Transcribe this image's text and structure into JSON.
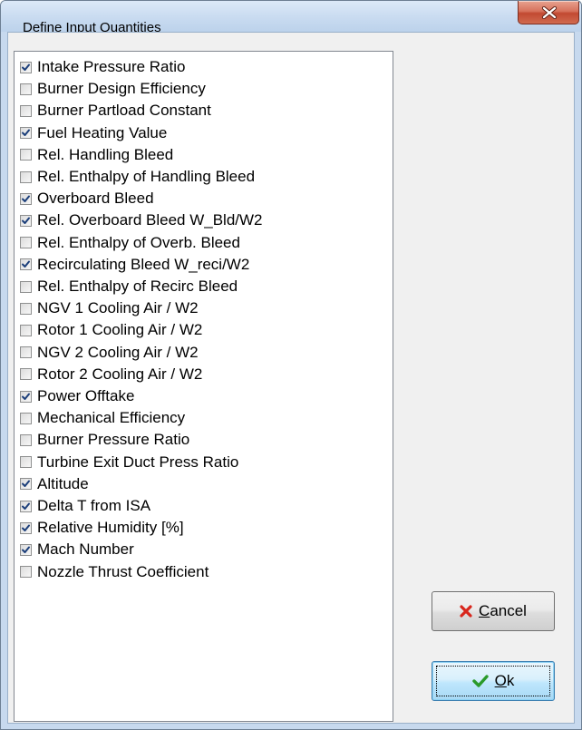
{
  "window": {
    "title": "Define Input Quantities"
  },
  "items": [
    {
      "label": "Intake Pressure Ratio",
      "checked": true
    },
    {
      "label": "Burner Design Efficiency",
      "checked": false
    },
    {
      "label": "Burner Partload Constant",
      "checked": false
    },
    {
      "label": "Fuel Heating Value",
      "checked": true
    },
    {
      "label": "Rel. Handling Bleed",
      "checked": false
    },
    {
      "label": "Rel. Enthalpy of Handling Bleed",
      "checked": false
    },
    {
      "label": "Overboard Bleed",
      "checked": true
    },
    {
      "label": "Rel. Overboard Bleed W_Bld/W2",
      "checked": true
    },
    {
      "label": "Rel. Enthalpy of Overb. Bleed",
      "checked": false
    },
    {
      "label": "Recirculating Bleed W_reci/W2",
      "checked": true
    },
    {
      "label": "Rel. Enthalpy of Recirc Bleed",
      "checked": false
    },
    {
      "label": "NGV 1 Cooling Air / W2",
      "checked": false
    },
    {
      "label": "Rotor 1 Cooling Air / W2",
      "checked": false
    },
    {
      "label": "NGV 2 Cooling Air / W2",
      "checked": false
    },
    {
      "label": "Rotor 2 Cooling Air / W2",
      "checked": false
    },
    {
      "label": "Power Offtake",
      "checked": true
    },
    {
      "label": "Mechanical Efficiency",
      "checked": false
    },
    {
      "label": "Burner Pressure Ratio",
      "checked": false
    },
    {
      "label": "Turbine Exit Duct Press Ratio",
      "checked": false
    },
    {
      "label": "Altitude",
      "checked": true
    },
    {
      "label": "Delta T from ISA",
      "checked": true
    },
    {
      "label": "Relative Humidity [%]",
      "checked": true
    },
    {
      "label": "Mach Number",
      "checked": true
    },
    {
      "label": "Nozzle Thrust Coefficient",
      "checked": false
    }
  ],
  "buttons": {
    "cancel": {
      "mnemonic": "C",
      "rest": "ancel",
      "icon": "red-x-icon"
    },
    "ok": {
      "mnemonic": "O",
      "rest": "k",
      "icon": "green-check-icon"
    }
  },
  "colors": {
    "cancel_icon": "#d8261c",
    "ok_icon": "#2a9a2a",
    "close_button": "#c9533a"
  }
}
